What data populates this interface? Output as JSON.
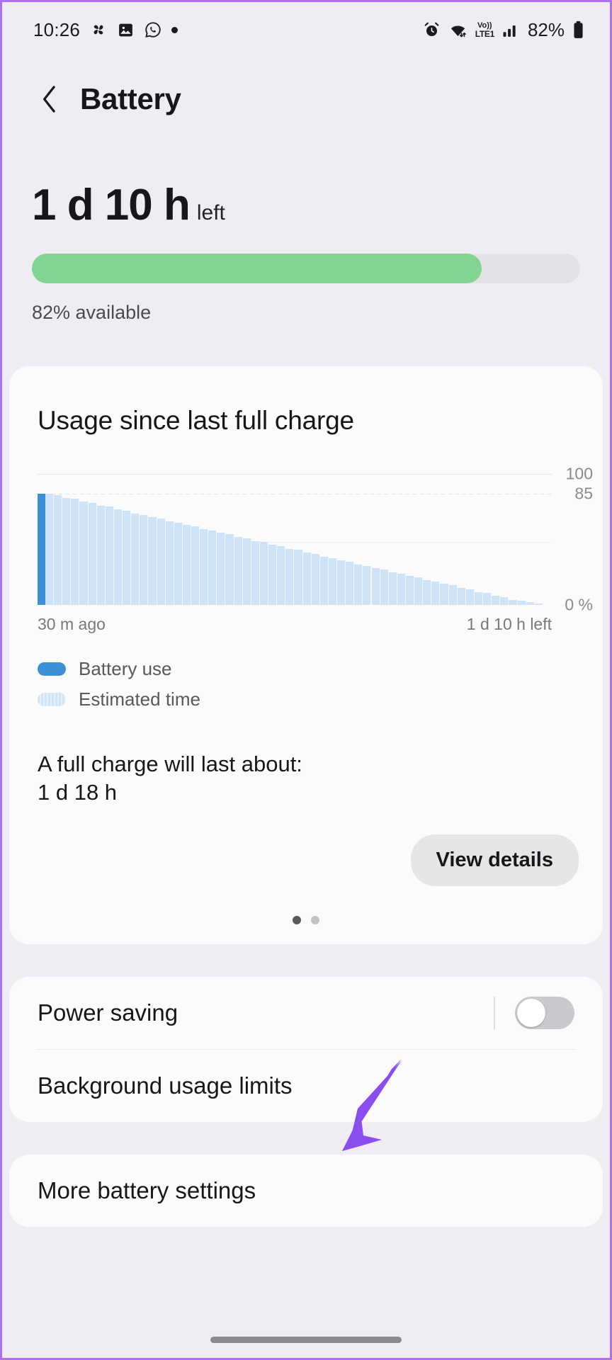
{
  "status_bar": {
    "time": "10:26",
    "left_icons": [
      "pinwheel-icon",
      "gallery-icon",
      "whatsapp-icon",
      "dot-icon"
    ],
    "right_icons": [
      "alarm-icon",
      "wifi-icon",
      "volte-icon",
      "signal-icon"
    ],
    "volte_line1": "Vo))",
    "volte_line2": "LTE1",
    "battery_percent": "82%"
  },
  "app_bar": {
    "back_icon": "chevron-left-icon",
    "title": "Battery"
  },
  "summary": {
    "time_remaining": "1 d 10 h",
    "time_suffix": "left",
    "available_text": "82% available",
    "battery_level": 82,
    "bar_color": "#81d492",
    "track_color": "#e4e2e7"
  },
  "usage_card": {
    "title": "Usage since last full charge",
    "legend": [
      {
        "label": "Battery use",
        "color": "#3d8fd6"
      },
      {
        "label": "Estimated time",
        "color": "#cfe4f6"
      }
    ],
    "x_left_label": "30 m ago",
    "x_right_label": "1 d 10 h left",
    "full_charge_label": "A full charge will last about:",
    "full_charge_value": "1 d 18 h",
    "view_details_label": "View details",
    "page_dots": 2,
    "active_dot": 0
  },
  "chart_data": {
    "type": "area",
    "title": "Usage since last full charge",
    "xlabel": "",
    "ylabel": "",
    "ylim": [
      0,
      100
    ],
    "y_ticks": [
      100,
      85,
      0
    ],
    "y_tick_labels": [
      "100",
      "85",
      "0 %"
    ],
    "grid": true,
    "legend_position": "below",
    "x_range_labels": [
      "30 m ago",
      "1 d 10 h left"
    ],
    "series": [
      {
        "name": "Battery use",
        "color": "#3d8fd6",
        "values": [
          85
        ]
      },
      {
        "name": "Estimated time",
        "color": "#cfe4f6",
        "values": [
          85,
          84,
          82,
          81,
          79,
          78,
          76,
          75,
          73,
          72,
          70,
          69,
          67,
          66,
          64,
          63,
          61,
          60,
          58,
          57,
          55,
          54,
          52,
          51,
          49,
          48,
          46,
          45,
          43,
          42,
          40,
          39,
          37,
          36,
          34,
          33,
          31,
          30,
          28,
          27,
          25,
          24,
          22,
          21,
          19,
          18,
          16,
          15,
          13,
          12,
          10,
          9,
          7,
          6,
          4,
          3,
          2,
          1,
          0
        ]
      }
    ]
  },
  "settings": {
    "group_one": [
      {
        "label": "Power saving",
        "control": "toggle",
        "state": "off"
      },
      {
        "label": "Background usage limits",
        "control": "none"
      }
    ],
    "group_two": [
      {
        "label": "More battery settings",
        "control": "none"
      }
    ]
  },
  "annotation": {
    "arrow_color": "#8c4df0"
  },
  "nav_bar": {
    "gesture_pill": "home-indicator"
  }
}
